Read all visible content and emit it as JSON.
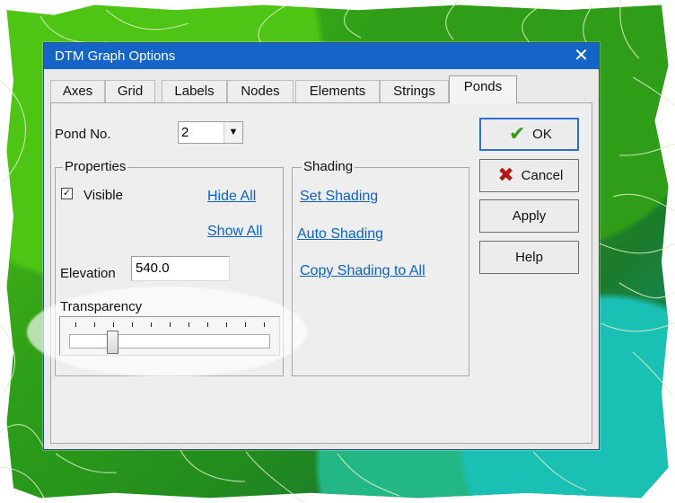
{
  "dialog": {
    "title": "DTM Graph Options",
    "close_icon": "close-icon"
  },
  "tabs": [
    {
      "label": "Axes",
      "active": false
    },
    {
      "label": "Grid",
      "active": false
    },
    {
      "label": "Labels",
      "active": false
    },
    {
      "label": "Nodes",
      "active": false
    },
    {
      "label": "Elements",
      "active": false
    },
    {
      "label": "Strings",
      "active": false
    },
    {
      "label": "Ponds",
      "active": true
    }
  ],
  "pond": {
    "label": "Pond No.",
    "selected_value": "2",
    "dropdown_icon": "chevron-down-icon"
  },
  "properties": {
    "title": "Properties",
    "visible_label": "Visible",
    "visible_checked": true,
    "hide_all": "Hide All",
    "show_all": "Show All",
    "elevation_label": "Elevation",
    "elevation_value": "540.0",
    "transparency_label": "Transparency",
    "transparency_value": 0.2
  },
  "shading": {
    "title": "Shading",
    "set_shading": "Set Shading",
    "auto_shading": "Auto Shading",
    "copy_shading": "Copy Shading to All"
  },
  "buttons": {
    "ok": "OK",
    "ok_icon": "check-icon",
    "cancel": "Cancel",
    "cancel_icon": "cancel-icon",
    "apply": "Apply",
    "help": "Help"
  },
  "colors": {
    "title_blue": "#1565c8",
    "link_blue": "#0c62c9",
    "ok_green": "#2e9e18",
    "cancel_red": "#b21a17"
  }
}
